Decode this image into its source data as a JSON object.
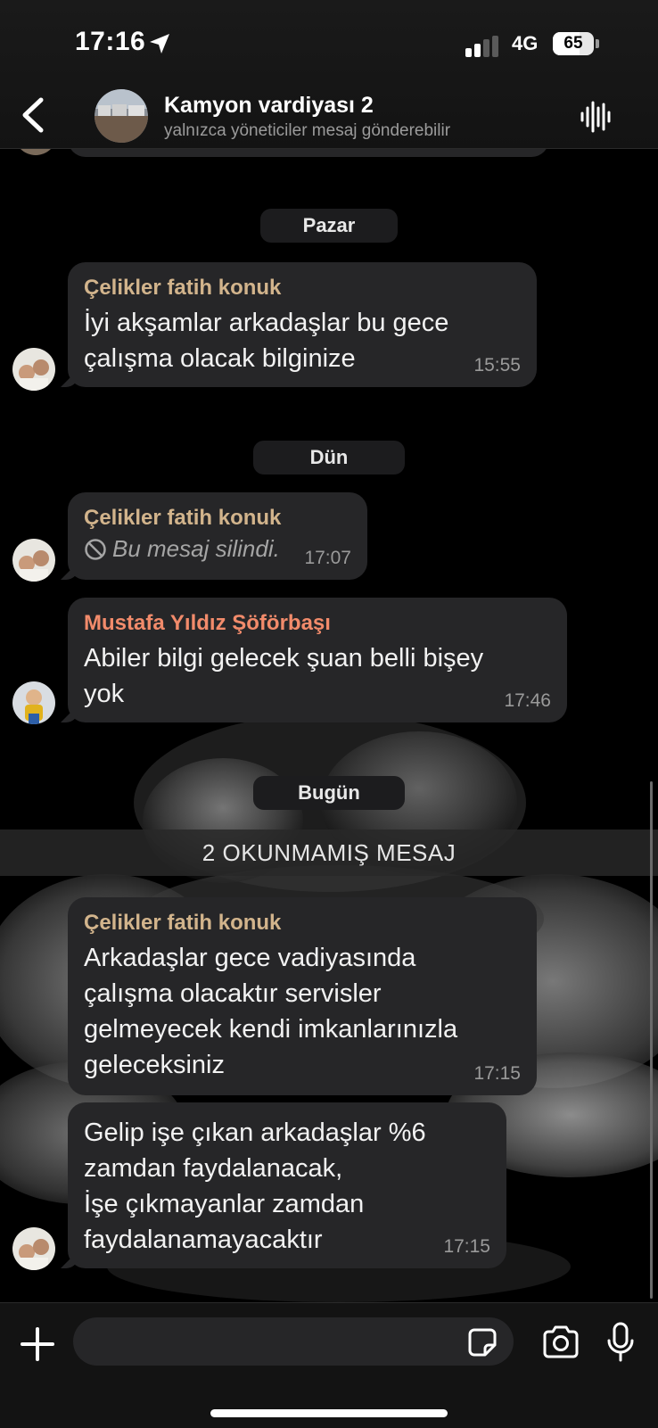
{
  "status": {
    "time": "17:16",
    "network": "4G",
    "battery": "65",
    "battery_level": 0.65
  },
  "header": {
    "title": "Kamyon vardiyası 2",
    "subtitle": "yalnızca yöneticiler mesaj gönderebilir"
  },
  "colors": {
    "sender_fatih": "#d2b48c",
    "sender_mustafa": "#f28b6b",
    "bubble": "#262628",
    "background": "#000000"
  },
  "chat": {
    "dates": {
      "sunday": "Pazar",
      "yesterday": "Dün",
      "today": "Bugün"
    },
    "unread_banner": "2 OKUNMAMIŞ MESAJ",
    "messages": [
      {
        "sender": "Çelikler fatih konuk",
        "text": "İyi akşamlar arkadaşlar bu gece\nçalışma olacak bilginize",
        "time": "15:55"
      },
      {
        "sender": "Çelikler fatih konuk",
        "text": "Bu mesaj silindi.",
        "time": "17:07",
        "deleted": true
      },
      {
        "sender": "Mustafa Yıldız Şöförbaşı",
        "text": "Abiler bilgi gelecek şuan belli bişey\nyok",
        "time": "17:46"
      },
      {
        "sender": "Çelikler fatih konuk",
        "text": "Arkadaşlar gece vadiyasında\nçalışma olacaktır servisler\ngelmeyecek kendi imkanlarınızla\ngeleceksiniz",
        "time": "17:15"
      },
      {
        "text": "Gelip işe çıkan arkadaşlar %6\nzamdan faydalanacak,\nİşe çıkmayanlar zamdan\nfaydalanamayacaktır",
        "time": "17:15"
      }
    ]
  },
  "input": {
    "placeholder": ""
  },
  "icons": {
    "back": "chevron-left-icon",
    "voice": "waveform-icon",
    "plus": "plus-icon",
    "sticker": "sticker-icon",
    "camera": "camera-icon",
    "mic": "microphone-icon",
    "deleted": "prohibited-icon",
    "location": "location-arrow-icon"
  }
}
